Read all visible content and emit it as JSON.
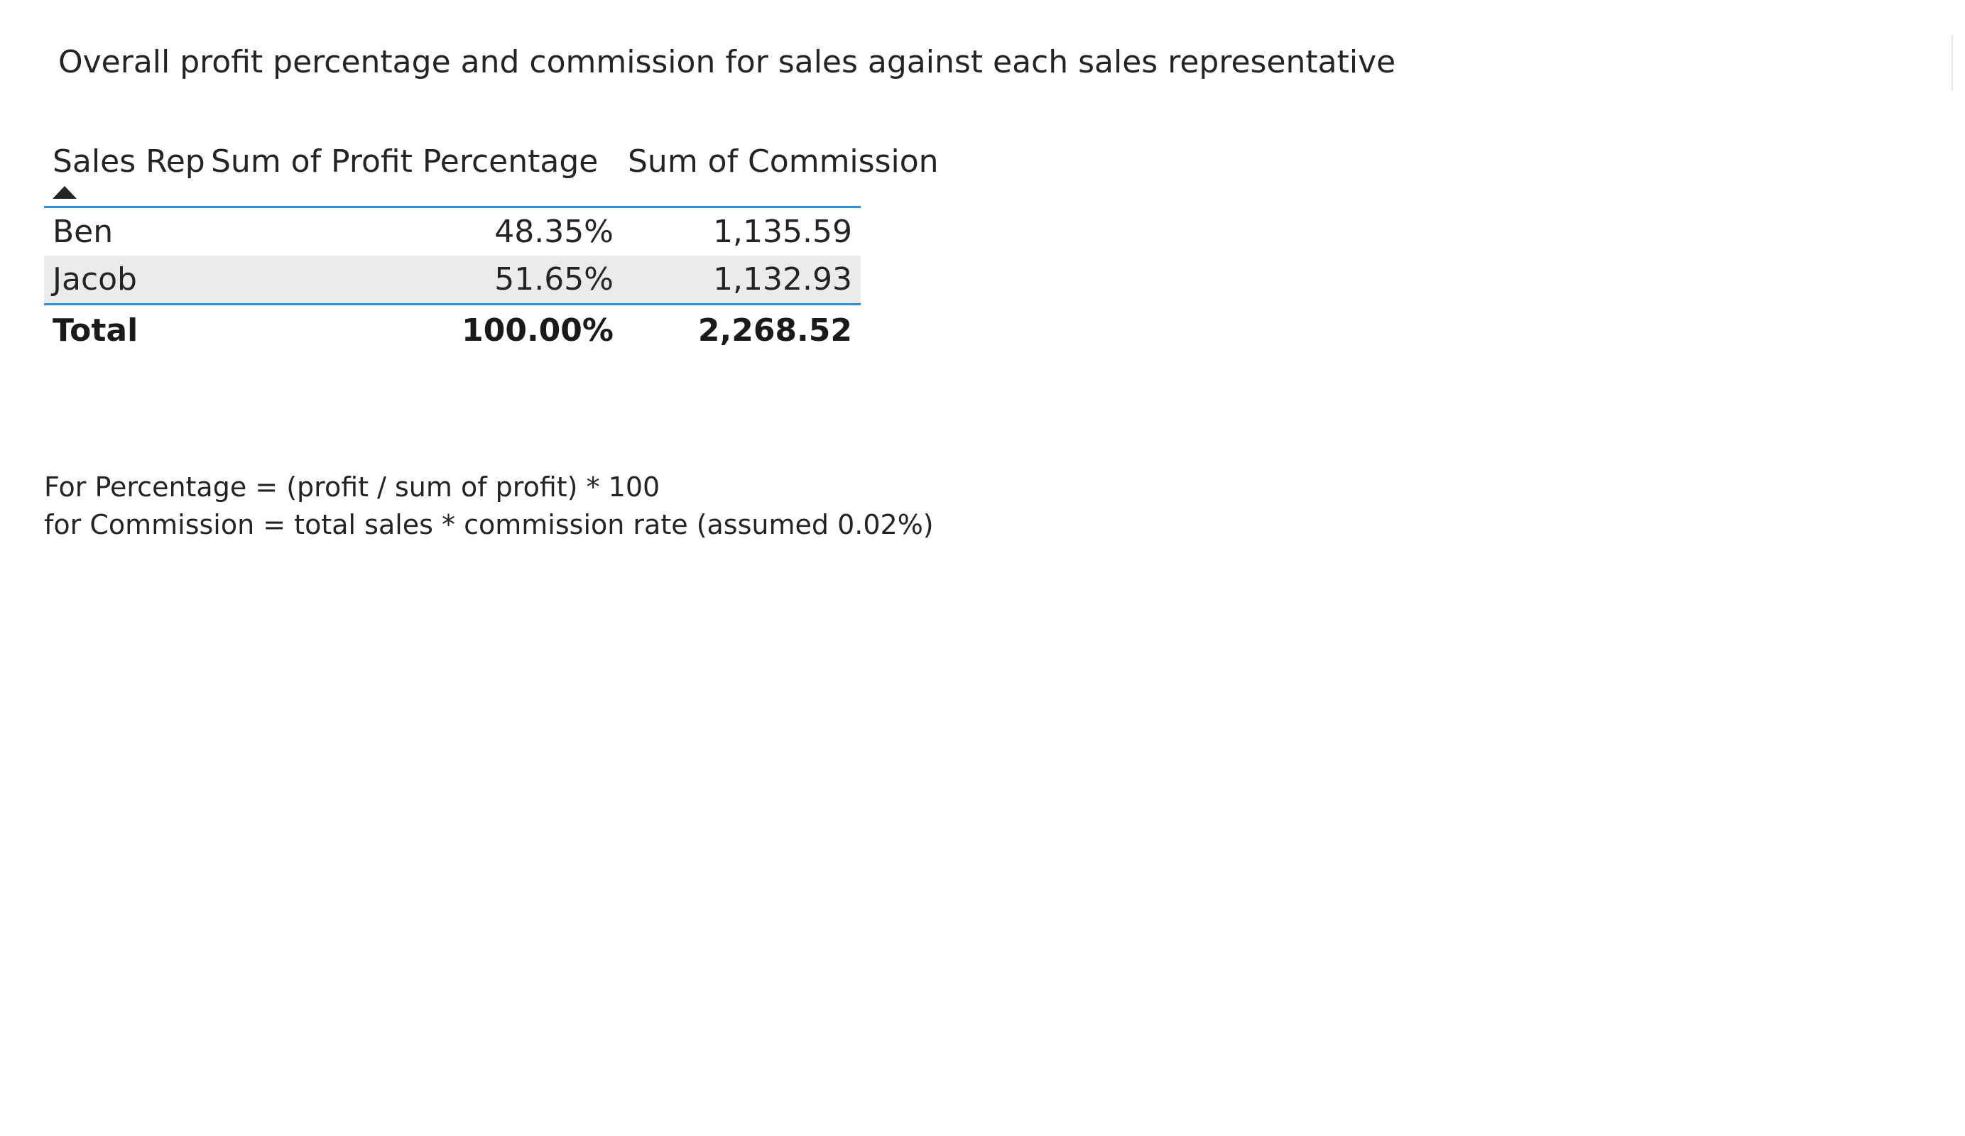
{
  "visual": {
    "title": "Overall profit percentage and commission for sales against each sales representative"
  },
  "table": {
    "columns": [
      "Sales Rep",
      "Sum of Profit Percentage",
      "Sum of Commission"
    ],
    "sort": {
      "column": "Sales Rep",
      "direction": "ascending"
    },
    "rows": [
      {
        "rep": "Ben",
        "profit_pct": "48.35%",
        "commission": "1,135.59"
      },
      {
        "rep": "Jacob",
        "profit_pct": "51.65%",
        "commission": "1,132.93"
      }
    ],
    "total": {
      "label": "Total",
      "profit_pct": "100.00%",
      "commission": "2,268.52"
    }
  },
  "notes": {
    "line1": "For Percentage = (profit / sum of profit) * 100",
    "line2": "for Commission = total sales * commission rate (assumed 0.02%)"
  },
  "colors": {
    "accent_line": "#2f8fd8",
    "alt_row": "#ebebeb",
    "text": "#252423"
  }
}
